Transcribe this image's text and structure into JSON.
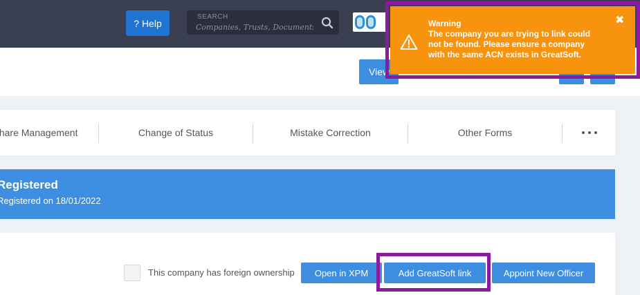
{
  "topbar": {
    "help_label": "? Help",
    "search_label": "SEARCH",
    "search_placeholder": "Companies, Trusts, Documents"
  },
  "header": {
    "view_label": "View"
  },
  "tabs": [
    {
      "label": "Share Management"
    },
    {
      "label": "Change of Status"
    },
    {
      "label": "Mistake Correction"
    },
    {
      "label": "Other Forms"
    }
  ],
  "banner": {
    "title": "Registered",
    "subtitle": "Registered on 18/01/2022"
  },
  "actions": {
    "foreign_ownership_label": "This company has foreign ownership",
    "open_xpm_label": "Open in XPM",
    "add_greatsoft_label": "Add GreatSoft link",
    "appoint_officer_label": "Appoint New Officer"
  },
  "warning": {
    "title": "Warning",
    "message": "The company you are trying to link could not be found. Please ensure a company with the same ACN exists in GreatSoft.",
    "close_glyph": "✖"
  },
  "colors": {
    "topbar": "#3b3f52",
    "primary": "#3d8de0",
    "help": "#1f73d1",
    "warning": "#f7930c",
    "highlight": "#8c1a9e"
  }
}
